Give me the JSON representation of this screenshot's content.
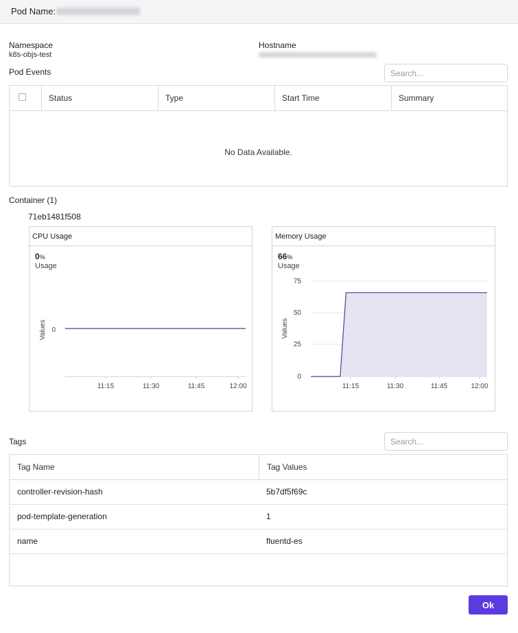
{
  "header": {
    "pod_name_label": "Pod Name:"
  },
  "details": {
    "namespace_label": "Namespace",
    "namespace_value": "k8s-objs-test",
    "hostname_label": "Hostname"
  },
  "pod_events": {
    "title": "Pod Events",
    "search_placeholder": "Search...",
    "columns": [
      "Status",
      "Type",
      "Start Time",
      "Summary"
    ],
    "empty_text": "No Data Available."
  },
  "container": {
    "title": "Container (1)",
    "id": "71eb1481f508"
  },
  "charts": {
    "cpu": {
      "title": "CPU Usage",
      "usage_value": "0",
      "usage_unit": "%",
      "usage_label": "Usage",
      "ylabel": "Values",
      "y_ticks": [
        "0"
      ],
      "x_ticks": [
        "11:15",
        "11:30",
        "11:45",
        "12:00"
      ]
    },
    "memory": {
      "title": "Memory Usage",
      "usage_value": "66",
      "usage_unit": "%",
      "usage_label": "Usage",
      "ylabel": "Values",
      "y_ticks": [
        "75",
        "50",
        "25",
        "0"
      ],
      "x_ticks": [
        "11:15",
        "11:30",
        "11:45",
        "12:00"
      ]
    }
  },
  "chart_data": [
    {
      "type": "line",
      "title": "CPU Usage",
      "xlabel": "",
      "ylabel": "Values",
      "x": [
        "11:00",
        "11:15",
        "11:30",
        "11:45",
        "12:00"
      ],
      "series": [
        {
          "values": [
            0,
            0,
            0,
            0,
            0
          ]
        }
      ],
      "grid": false
    },
    {
      "type": "area",
      "title": "Memory Usage",
      "xlabel": "",
      "ylabel": "Values",
      "ylim": [
        0,
        75
      ],
      "x": [
        "11:00",
        "11:10",
        "11:12",
        "11:15",
        "11:30",
        "11:45",
        "12:00"
      ],
      "series": [
        {
          "values": [
            0,
            0,
            66,
            66,
            66,
            66,
            66
          ]
        }
      ],
      "grid": true
    }
  ],
  "tags": {
    "title": "Tags",
    "search_placeholder": "Search...",
    "columns": [
      "Tag Name",
      "Tag Values"
    ],
    "rows": [
      {
        "name": "controller-revision-hash",
        "value": "5b7df5f69c"
      },
      {
        "name": "pod-template-generation",
        "value": "1"
      },
      {
        "name": "name",
        "value": "fluentd-es"
      }
    ]
  },
  "footer": {
    "ok_label": "Ok"
  },
  "colors": {
    "accent": "#5b3be0",
    "line": "#4b3f9a",
    "area_fill": "#e6e3f2"
  }
}
